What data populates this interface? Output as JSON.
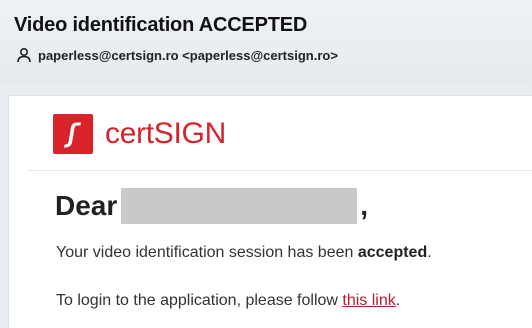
{
  "email": {
    "subject": "Video identification ACCEPTED",
    "sender": "paperless@certsign.ro <paperless@certsign.ro>",
    "sender_icon": "person-icon"
  },
  "brand": {
    "logo_text": "certSIGN",
    "logo_mark_letter": "S",
    "accent_color": "#d8232a"
  },
  "body": {
    "greeting": "Dear",
    "greeting_punct": ",",
    "line1_text": "Your video identification session has been ",
    "line1_bold": "accepted",
    "line1_end": ".",
    "line2_text": "To login to the application, please follow ",
    "line2_link": "this link",
    "line2_end": "."
  }
}
